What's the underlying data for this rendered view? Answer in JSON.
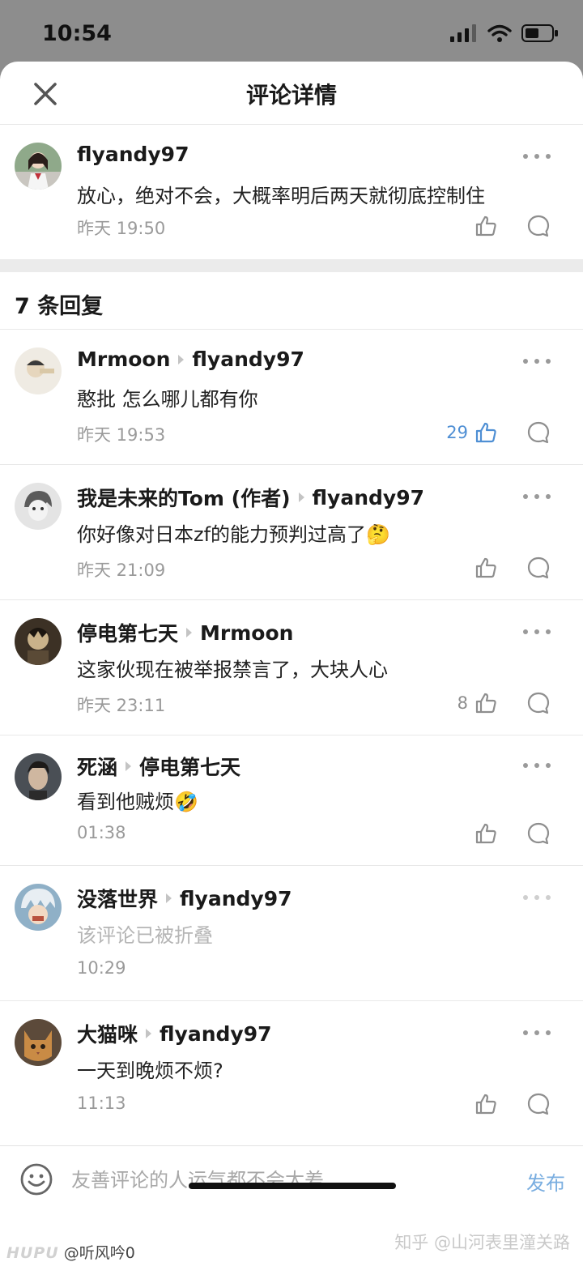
{
  "status": {
    "time": "10:54"
  },
  "header": {
    "title": "评论详情"
  },
  "main_comment": {
    "user": "flyandy97",
    "text": "放心，绝对不会，大概率明后两天就彻底控制住",
    "time": "昨天 19:50"
  },
  "replies_header": "7 条回复",
  "replies": [
    {
      "user": "Mrmoon",
      "target": "flyandy97",
      "text": "憨批 怎么哪儿都有你",
      "time": "昨天 19:53",
      "likes": "29",
      "folded": false
    },
    {
      "user": "我是未来的Tom (作者)",
      "target": "flyandy97",
      "text": "你好像对日本zf的能力预判过高了🤔",
      "time": "昨天 21:09",
      "likes": "",
      "folded": false
    },
    {
      "user": "停电第七天",
      "target": "Mrmoon",
      "text": "这家伙现在被举报禁言了，大块人心",
      "time": "昨天 23:11",
      "likes": "8",
      "folded": false
    },
    {
      "user": "死涵",
      "target": "停电第七天",
      "text": "看到他贼烦🤣",
      "time": "01:38",
      "likes": "",
      "folded": false
    },
    {
      "user": "没落世界",
      "target": "flyandy97",
      "text": "该评论已被折叠",
      "time": "10:29",
      "likes": "",
      "folded": true
    },
    {
      "user": "大猫咪",
      "target": "flyandy97",
      "text": "一天到晚烦不烦?",
      "time": "11:13",
      "likes": "",
      "folded": false
    }
  ],
  "input": {
    "placeholder": "友善评论的人运气都不会太差",
    "publish_label": "发布"
  },
  "watermarks": {
    "left_logo": "HUPU",
    "left_user": "@听风吟0",
    "right": "知乎 @山河表里潼关路"
  },
  "colors": {
    "accent": "#4f8fd4",
    "publish": "#7aaee0",
    "status_bg": "#8d8d8d"
  },
  "icons": [
    "close-icon",
    "more-icon",
    "thumbs-up-icon",
    "reply-bubble-icon",
    "emoji-icon",
    "signal-icon",
    "wifi-icon",
    "battery-icon"
  ]
}
